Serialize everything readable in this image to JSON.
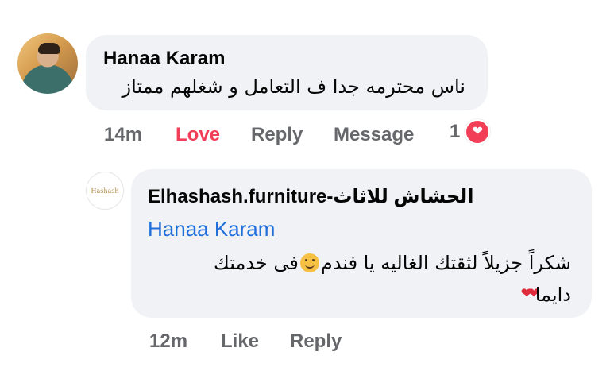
{
  "comment": {
    "author": "Hanaa Karam",
    "text": "ناس محترمه جدا ف التعامل  و شغلهم ممتاز",
    "time": "14m",
    "reaction_label": "Love",
    "reply_label": "Reply",
    "message_label": "Message",
    "reaction_count": "1",
    "reaction_icon": "heart-icon"
  },
  "reply": {
    "author": "Elhashash.furniture-الحشاش للاثاث",
    "mention": "Hanaa Karam",
    "text_line1_a": "شكراً جزيلاً لثقتك الغاليه يا فندم",
    "text_line1_b": "فى خدمتك",
    "text_line2": "دايما",
    "time": "12m",
    "like_label": "Like",
    "reply_label": "Reply",
    "avatar_logo_text": "Hashash"
  },
  "colors": {
    "bubble": "#f0f2f5",
    "love": "#f33e58",
    "mention": "#216fdb",
    "meta": "#65676b"
  }
}
